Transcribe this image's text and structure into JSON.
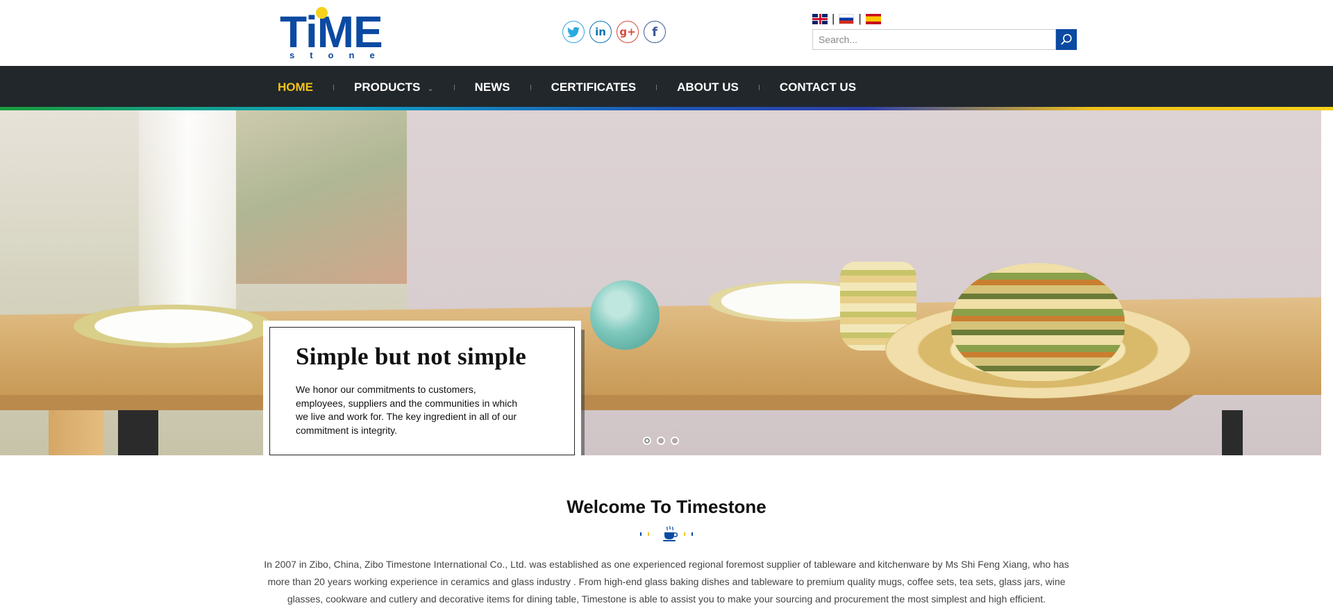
{
  "logo": {
    "main": "TiME",
    "sub": "stone"
  },
  "social": [
    {
      "name": "twitter",
      "glyph": "t",
      "color": "#2aa9e0"
    },
    {
      "name": "linkedin",
      "glyph": "in",
      "color": "#0b73b2"
    },
    {
      "name": "google-plus",
      "glyph": "g+",
      "color": "#d9473b"
    },
    {
      "name": "facebook",
      "glyph": "f",
      "color": "#3b5998"
    }
  ],
  "search": {
    "placeholder": "Search..."
  },
  "nav": {
    "items": [
      {
        "label": "HOME",
        "active": true
      },
      {
        "label": "PRODUCTS",
        "has_dropdown": true
      },
      {
        "label": "NEWS"
      },
      {
        "label": "CERTIFICATES"
      },
      {
        "label": "ABOUT US"
      },
      {
        "label": "CONTACT US"
      }
    ]
  },
  "hero": {
    "title": "Simple but not simple",
    "text": "We honor our commitments to customers, employees, suppliers and the communities in which we live and work for. The key ingredient in all of our commitment is integrity.",
    "slide_count": 3,
    "active_slide": 1
  },
  "welcome": {
    "title": "Welcome To Timestone",
    "body": "In 2007 in Zibo, China, Zibo Timestone International Co., Ltd. was established as one experienced regional foremost supplier of tableware and kitchenware by Ms Shi Feng Xiang, who has more than 20 years working experience in ceramics and glass industry . From high-end glass baking dishes and tableware to premium quality mugs, coffee sets, tea sets, glass jars, wine glasses, cookware and cutlery and decorative items for dining table, Timestone is able to assist you to make your sourcing and procurement the most simplest and high efficient."
  },
  "colors": {
    "brand_blue": "#0b4aa2",
    "accent_yellow": "#f3c31b",
    "nav_bg": "#21272b"
  }
}
